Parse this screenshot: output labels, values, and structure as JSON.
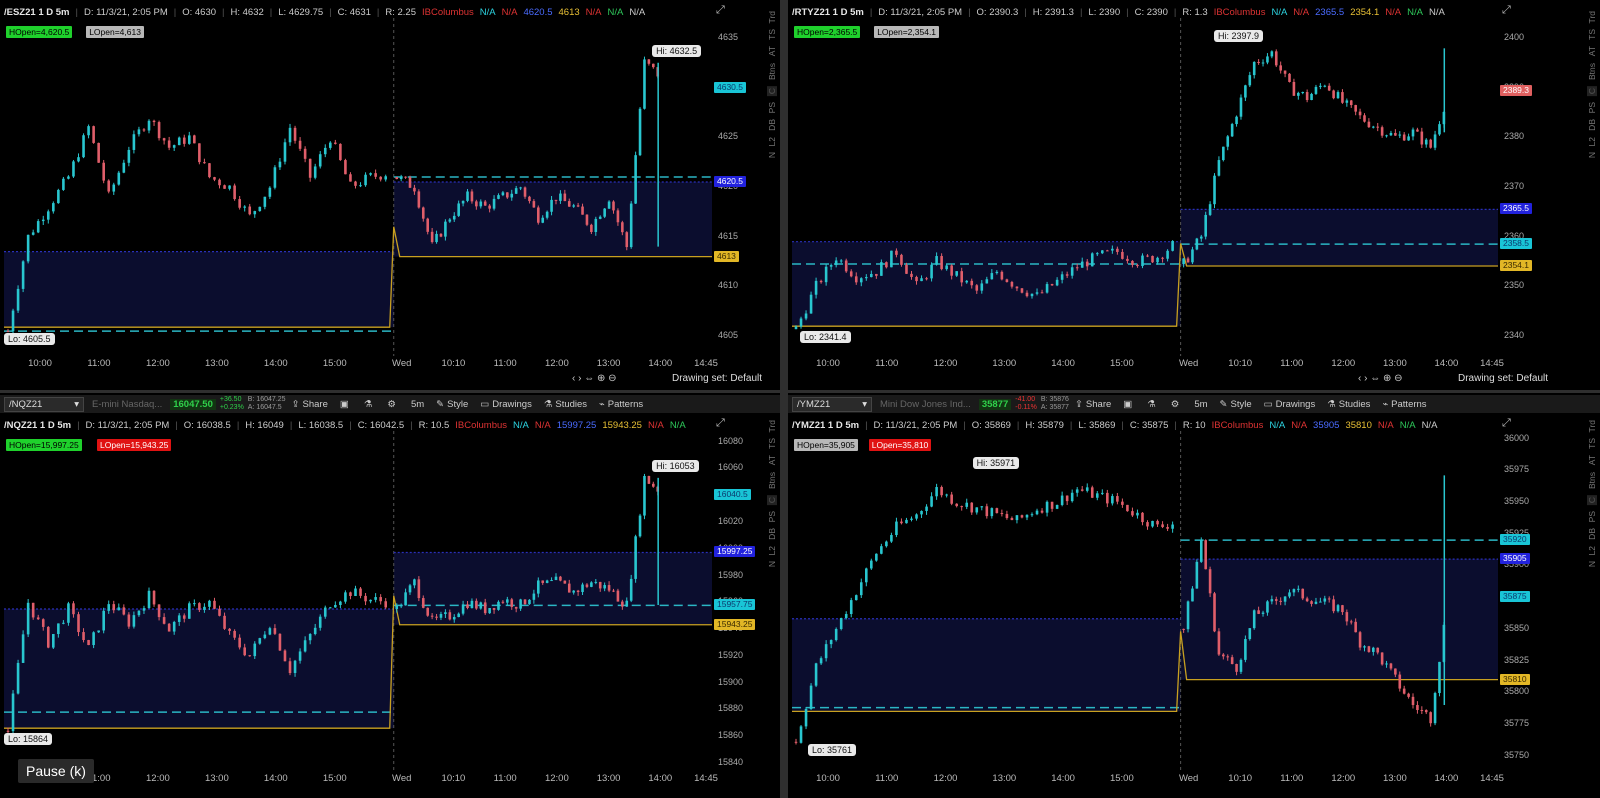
{
  "panes": [
    {
      "id": "es",
      "header": [
        "/ESZ21 1 D 5m",
        "D: 11/3/21, 2:05 PM",
        "O: 4630",
        "H: 4632",
        "L: 4629.75",
        "C: 4631",
        "R: 2.25"
      ],
      "header_colored": [
        {
          "text": "IBColumbus",
          "cls": "red"
        },
        {
          "text": "N/A",
          "cls": "cyan"
        },
        {
          "text": "N/A",
          "cls": "red"
        },
        {
          "text": "4620.5",
          "cls": "blue"
        },
        {
          "text": "4613",
          "cls": "gold"
        },
        {
          "text": "N/A",
          "cls": "red"
        },
        {
          "text": "N/A",
          "cls": "grn"
        },
        {
          "text": "N/A",
          "cls": ""
        }
      ],
      "tags": [
        {
          "text": "HOpen=4,620.5",
          "cls": "tag-green"
        },
        {
          "text": "LOpen=4,613",
          "cls": "tag-gray"
        }
      ],
      "yticks": [
        "4635",
        "4630",
        "4625",
        "4620",
        "4615",
        "4610",
        "4605"
      ],
      "ytick_vals": [
        4635,
        4630,
        4625,
        4620,
        4615,
        4610,
        4605
      ],
      "ymin": 4603,
      "ymax": 4637,
      "xticks": [
        "10:00",
        "11:00",
        "12:00",
        "13:00",
        "14:00",
        "15:00",
        "Wed",
        "10:10",
        "11:00",
        "12:00",
        "13:00",
        "14:00",
        "14:45"
      ],
      "hi_label": "Hi: 4632.5",
      "lo_label": "Lo: 4605.5",
      "hi": 4632.5,
      "lo": 4605.5,
      "price_boxes": [
        {
          "text": "4630.5",
          "val": 4630,
          "bg": "#19c5d6",
          "fg": "#0b3a6d"
        },
        {
          "text": "4620.5",
          "val": 4620.5,
          "bg": "#2222dd",
          "fg": "#fff"
        },
        {
          "text": "4613",
          "val": 4613,
          "bg": "#e2b726",
          "fg": "#3a2a00"
        }
      ],
      "levels": {
        "prev_dash": 4605.5,
        "prev_dot": 4613.5,
        "prev_gold": 4605.9,
        "cur_dash": 4621,
        "cur_gold": 4613,
        "box_top": 4620.5,
        "box_bot": 4613,
        "prev_box_top": 4613.5
      },
      "series": {
        "start": 4605.7,
        "day1": [
          4605.5,
          4615,
          4618,
          4621,
          4626,
          4619,
          4624,
          4627,
          4624,
          4625,
          4621,
          4620,
          4617,
          4620,
          4626,
          4621,
          4625,
          4620,
          4621,
          4621.5
        ],
        "day2": [
          4620,
          4614,
          4617,
          4619,
          4618,
          4619,
          4620,
          4617,
          4619,
          4618,
          4616,
          4619,
          4614,
          4632.5,
          4631
        ],
        "open2": 4621
      },
      "drawing_set": "Drawing set: Default",
      "right_strip": [
        "Trd",
        "TS",
        "AT",
        "Btns",
        "C",
        "PS",
        "DB",
        "L2",
        "N"
      ]
    },
    {
      "id": "rty",
      "header": [
        "/RTYZ21 1 D 5m",
        "D: 11/3/21, 2:05 PM",
        "O: 2390.3",
        "H: 2391.3",
        "L: 2390",
        "C: 2390",
        "R: 1.3"
      ],
      "header_colored": [
        {
          "text": "IBColumbus",
          "cls": "red"
        },
        {
          "text": "N/A",
          "cls": "cyan"
        },
        {
          "text": "N/A",
          "cls": "red"
        },
        {
          "text": "2365.5",
          "cls": "blue"
        },
        {
          "text": "2354.1",
          "cls": "gold"
        },
        {
          "text": "N/A",
          "cls": "red"
        },
        {
          "text": "N/A",
          "cls": "grn"
        },
        {
          "text": "N/A",
          "cls": ""
        }
      ],
      "tags": [
        {
          "text": "HOpen=2,365.5",
          "cls": "tag-green"
        },
        {
          "text": "LOpen=2,354.1",
          "cls": "tag-gray"
        }
      ],
      "yticks": [
        "2400",
        "2390",
        "2380",
        "2370",
        "2360",
        "2350",
        "2340"
      ],
      "ytick_vals": [
        2400,
        2390,
        2380,
        2370,
        2360,
        2350,
        2340
      ],
      "ymin": 2336,
      "ymax": 2404,
      "xticks": [
        "10:00",
        "11:00",
        "12:00",
        "13:00",
        "14:00",
        "15:00",
        "Wed",
        "10:10",
        "11:00",
        "12:00",
        "13:00",
        "14:00",
        "14:45"
      ],
      "hi_label": "Hi: 2397.9",
      "lo_label": "Lo: 2341.4",
      "hi": 2397.9,
      "lo": 2341.4,
      "price_boxes": [
        {
          "text": "2389.3",
          "val": 2389.3,
          "bg": "#e06060",
          "fg": "#fff"
        },
        {
          "text": "2365.5",
          "val": 2365.5,
          "bg": "#2222dd",
          "fg": "#fff"
        },
        {
          "text": "2358.5",
          "val": 2358.5,
          "bg": "#19c5d6",
          "fg": "#0b3a6d"
        },
        {
          "text": "2354.1",
          "val": 2354.1,
          "bg": "#e2b726",
          "fg": "#3a2a00"
        }
      ],
      "levels": {
        "prev_dash": 2354.5,
        "prev_dot": 2359,
        "prev_gold": 2342,
        "cur_dash": 2358.5,
        "cur_gold": 2354.1,
        "box_top": 2365.5,
        "box_bot": 2354.1,
        "prev_box_top": 2359
      },
      "series": {
        "start": 2350,
        "day1": [
          2341.4,
          2350,
          2356,
          2352,
          2353,
          2357,
          2350,
          2355,
          2352,
          2349,
          2353,
          2350,
          2348,
          2351,
          2354,
          2356,
          2357,
          2355,
          2356,
          2359
        ],
        "day2": [
          2360,
          2375,
          2385,
          2395,
          2397,
          2390,
          2388,
          2391,
          2387,
          2384,
          2382,
          2380,
          2381,
          2378,
          2389
        ],
        "open2": 2354.5
      },
      "drawing_set": "Drawing set: Default",
      "right_strip": [
        "Trd",
        "TS",
        "AT",
        "Btns",
        "C",
        "PS",
        "DB",
        "L2",
        "N"
      ]
    },
    {
      "id": "nq",
      "toolbar": {
        "symbol": "/NQZ21",
        "desc": "E-mini Nasdaq...",
        "last": "16047.50",
        "chg1": "+36.50",
        "chg2": "+0.23%",
        "chg3": "B: 16047.25",
        "chg4": "A: 16047.5",
        "items": [
          "Share",
          "Style",
          "Drawings",
          "Studies",
          "Patterns"
        ],
        "interval": "5m"
      },
      "header": [
        "/NQZ21 1 D 5m",
        "D: 11/3/21, 2:05 PM",
        "O: 16038.5",
        "H: 16049",
        "L: 16038.5",
        "C: 16042.5",
        "R: 10.5"
      ],
      "header_colored": [
        {
          "text": "IBColumbus",
          "cls": "red"
        },
        {
          "text": "N/A",
          "cls": "cyan"
        },
        {
          "text": "N/A",
          "cls": "red"
        },
        {
          "text": "15997.25",
          "cls": "blue"
        },
        {
          "text": "15943.25",
          "cls": "gold"
        },
        {
          "text": "N/A",
          "cls": "red"
        },
        {
          "text": "N/A",
          "cls": "grn"
        }
      ],
      "tags": [
        {
          "text": "HOpen=15,997.25",
          "cls": "tag-green"
        },
        {
          "text": "LOpen=15,943.25",
          "cls": "tag-red"
        }
      ],
      "yticks": [
        "16080",
        "16060",
        "16040",
        "16020",
        "16000",
        "15980",
        "15960",
        "15940",
        "15920",
        "15900",
        "15880",
        "15860",
        "15840"
      ],
      "ytick_vals": [
        16080,
        16060,
        16040,
        16020,
        16000,
        15980,
        15960,
        15940,
        15920,
        15900,
        15880,
        15860,
        15840
      ],
      "ymin": 15834,
      "ymax": 16088,
      "xticks": [
        "11:00",
        "12:00",
        "13:00",
        "14:00",
        "15:00",
        "Wed",
        "10:10",
        "11:00",
        "12:00",
        "13:00",
        "14:00",
        "14:45"
      ],
      "hi_label": "Hi: 16053",
      "lo_label": "Lo: 15864",
      "hi": 16053,
      "lo": 15864,
      "price_boxes": [
        {
          "text": "16040.5",
          "val": 16040.5,
          "bg": "#19c5d6",
          "fg": "#0b3a6d"
        },
        {
          "text": "15997.25",
          "val": 15997.25,
          "bg": "#2222dd",
          "fg": "#fff"
        },
        {
          "text": "15957.75",
          "val": 15957.75,
          "bg": "#19c5d6",
          "fg": "#0b3a6d"
        },
        {
          "text": "15943.25",
          "val": 15943.25,
          "bg": "#e2b726",
          "fg": "#3a2a00"
        }
      ],
      "levels": {
        "prev_dash": 15878,
        "prev_dot": 15955,
        "prev_gold": 15866,
        "cur_dash": 15957.75,
        "cur_gold": 15943.25,
        "box_top": 15997.25,
        "box_bot": 15943.25,
        "prev_box_top": 15955
      },
      "series": {
        "start": 15870,
        "day1": [
          15864,
          15960,
          15930,
          15955,
          15925,
          15960,
          15945,
          15965,
          15940,
          15955,
          15960,
          15935,
          15920,
          15945,
          15910,
          15935,
          15960,
          15968,
          15962,
          15960
        ],
        "day2": [
          15975,
          15945,
          15950,
          15960,
          15955,
          15962,
          15958,
          15972,
          15975,
          15968,
          15975,
          15970,
          15958,
          16053,
          16042
        ],
        "open2": 15955
      },
      "right_strip": [
        "Trd",
        "TS",
        "AT",
        "Btns",
        "C",
        "PS",
        "DB",
        "L2",
        "N"
      ]
    },
    {
      "id": "ym",
      "toolbar": {
        "symbol": "/YMZ21",
        "desc": "Mini Dow Jones Ind...",
        "last": "35877",
        "chg1": "-41.00",
        "chg2": "-0.11%",
        "chg3": "B: 35876",
        "chg4": "A: 35877",
        "items": [
          "Share",
          "Style",
          "Drawings",
          "Studies",
          "Patterns"
        ],
        "interval": "5m"
      },
      "header": [
        "/YMZ21 1 D 5m",
        "D: 11/3/21, 2:05 PM",
        "O: 35869",
        "H: 35879",
        "L: 35869",
        "C: 35875",
        "R: 10"
      ],
      "header_colored": [
        {
          "text": "IBColumbus",
          "cls": "red"
        },
        {
          "text": "N/A",
          "cls": "cyan"
        },
        {
          "text": "N/A",
          "cls": "red"
        },
        {
          "text": "35905",
          "cls": "blue"
        },
        {
          "text": "35810",
          "cls": "gold"
        },
        {
          "text": "N/A",
          "cls": "red"
        },
        {
          "text": "N/A",
          "cls": "grn"
        },
        {
          "text": "N/A",
          "cls": ""
        }
      ],
      "tags": [
        {
          "text": "HOpen=35,905",
          "cls": "tag-gray"
        },
        {
          "text": "LOpen=35,810",
          "cls": "tag-red"
        }
      ],
      "yticks": [
        "36000",
        "35975",
        "35950",
        "35925",
        "35900",
        "35875",
        "35850",
        "35825",
        "35800",
        "35775",
        "35750"
      ],
      "ytick_vals": [
        36000,
        35975,
        35950,
        35925,
        35900,
        35875,
        35850,
        35825,
        35800,
        35775,
        35750
      ],
      "ymin": 35738,
      "ymax": 36006,
      "xticks": [
        "10:00",
        "11:00",
        "12:00",
        "13:00",
        "14:00",
        "15:00",
        "Wed",
        "10:10",
        "11:00",
        "12:00",
        "13:00",
        "14:00",
        "14:45"
      ],
      "hi_label": "Hi: 35971",
      "lo_label": "Lo: 35761",
      "hi": 35971,
      "lo": 35761,
      "price_boxes": [
        {
          "text": "35920",
          "val": 35920,
          "bg": "#19c5d6",
          "fg": "#0b3a6d"
        },
        {
          "text": "35905",
          "val": 35905,
          "bg": "#2222dd",
          "fg": "#fff"
        },
        {
          "text": "35875",
          "val": 35875,
          "bg": "#19c5d6",
          "fg": "#0b3a6d"
        },
        {
          "text": "35810",
          "val": 35810,
          "bg": "#e2b726",
          "fg": "#3a2a00"
        }
      ],
      "levels": {
        "prev_dash": 35788,
        "prev_dot": 35858,
        "prev_gold": 35785,
        "cur_dash": 35920,
        "cur_gold": 35810,
        "box_top": 35905,
        "box_bot": 35810,
        "prev_box_top": 35858
      },
      "series": {
        "start": 35800,
        "day1": [
          35761,
          35820,
          35850,
          35880,
          35910,
          35930,
          35940,
          35960,
          35950,
          35945,
          35940,
          35935,
          35945,
          35950,
          35960,
          35955,
          35950,
          35940,
          35930,
          35935
        ],
        "day2": [
          35920,
          35830,
          35820,
          35860,
          35870,
          35880,
          35875,
          35870,
          35865,
          35840,
          35830,
          35810,
          35790,
          35780,
          35875
        ],
        "open2": 35850
      },
      "right_strip": [
        "Trd",
        "TS",
        "AT",
        "Btns",
        "C",
        "PS",
        "DB",
        "L2",
        "N"
      ]
    }
  ],
  "pause_label": "Pause (k)"
}
